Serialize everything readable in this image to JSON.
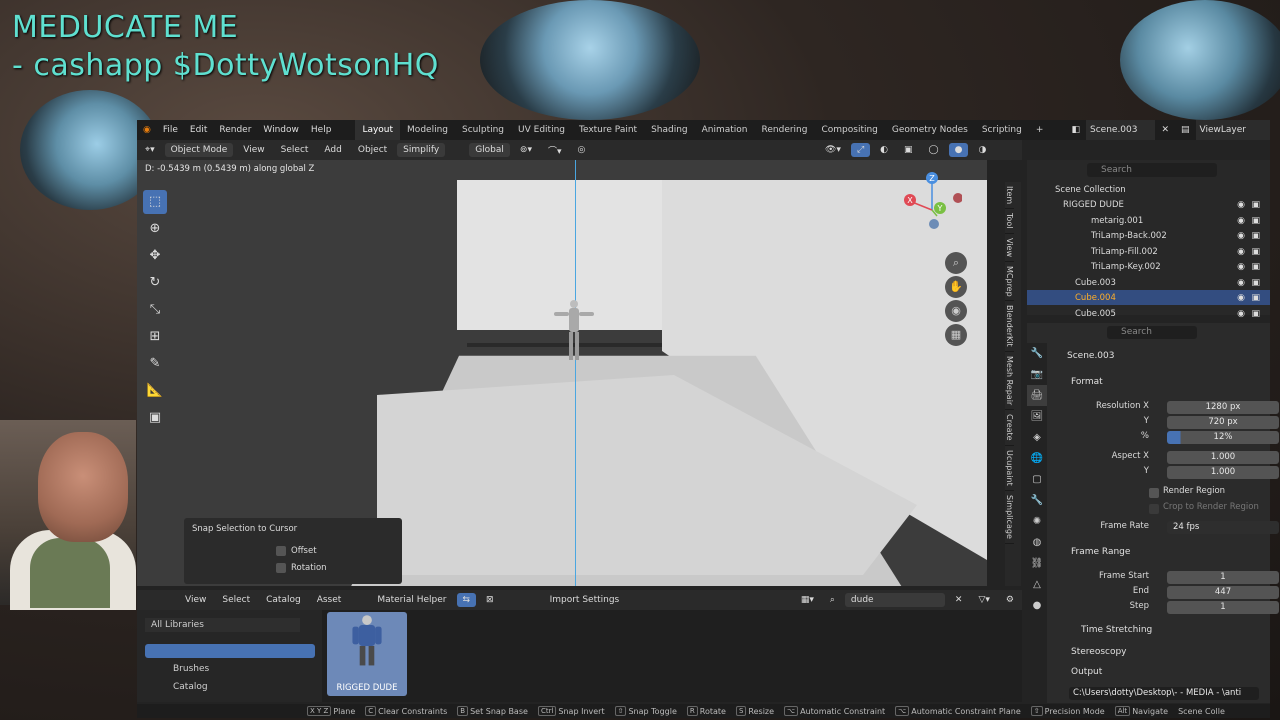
{
  "overlay": {
    "line1": "MEDUCATE ME",
    "line2": "- cashapp $DottyWotsonHQ"
  },
  "topbar": {
    "menus": [
      "File",
      "Edit",
      "Render",
      "Window",
      "Help"
    ],
    "workspaces": [
      "Layout",
      "Modeling",
      "Sculpting",
      "UV Editing",
      "Texture Paint",
      "Shading",
      "Animation",
      "Rendering",
      "Compositing",
      "Geometry Nodes",
      "Scripting"
    ],
    "active_workspace": "Layout",
    "scene": "Scene.003",
    "viewlayer": "ViewLayer"
  },
  "viewport_header": {
    "mode": "Object Mode",
    "menus": [
      "View",
      "Select",
      "Add",
      "Object"
    ],
    "simplify": "Simplify",
    "orientation": "Global"
  },
  "viewport": {
    "operator_status": "D: -0.5439 m (0.5439 m) along global Z",
    "gizmo": {
      "x": "X",
      "y": "Y",
      "z": "Z"
    },
    "side_tabs": [
      "Item",
      "Tool",
      "View",
      "MCprep",
      "BlenderKit",
      "Mesh Repair",
      "Create",
      "Ucupaint",
      "Simplicage"
    ]
  },
  "snap_panel": {
    "title": "Snap Selection to Cursor",
    "offset": "Offset",
    "rotation": "Rotation"
  },
  "asset_browser": {
    "menus": [
      "View",
      "Select",
      "Catalog",
      "Asset"
    ],
    "material_helper": "Material Helper",
    "import_settings": "Import Settings",
    "library": "All Libraries",
    "search": "dude",
    "side_items": [
      "Brushes",
      "Catalog"
    ],
    "asset_name": "RIGGED DUDE"
  },
  "outliner": {
    "search_placeholder": "Search",
    "rows": [
      {
        "label": "Scene Collection",
        "level": 0
      },
      {
        "label": "RIGGED DUDE",
        "level": 1
      },
      {
        "label": "metarig.001",
        "level": 2
      },
      {
        "label": "TriLamp-Back.002",
        "level": 2
      },
      {
        "label": "TriLamp-Fill.002",
        "level": 2
      },
      {
        "label": "TriLamp-Key.002",
        "level": 2
      },
      {
        "label": "Cube.003",
        "level": 1
      },
      {
        "label": "Cube.004",
        "level": 1
      },
      {
        "label": "Cube.005",
        "level": 1
      }
    ],
    "selected": "Cube.004"
  },
  "properties": {
    "search_placeholder": "Search",
    "scene_name": "Scene.003",
    "format_label": "Format",
    "resolution_x_label": "Resolution X",
    "resolution_x": "1280 px",
    "y_label": "Y",
    "resolution_y": "720 px",
    "pct_label": "%",
    "resolution_pct": "12%",
    "aspect_x_label": "Aspect X",
    "aspect_x": "1.000",
    "aspect_y_label": "Y",
    "aspect_y": "1.000",
    "render_region": "Render Region",
    "crop_region": "Crop to Render Region",
    "frame_rate_label": "Frame Rate",
    "frame_rate": "24 fps",
    "frame_range_label": "Frame Range",
    "frame_start_label": "Frame Start",
    "frame_start": "1",
    "end_label": "End",
    "frame_end": "447",
    "step_label": "Step",
    "frame_step": "1",
    "time_stretching": "Time Stretching",
    "stereoscopy": "Stereoscopy",
    "output": "Output",
    "output_path": "C:\\Users\\dotty\\Desktop\\- - MEDIA - \\anti"
  },
  "status_bar": [
    {
      "key": "X Y Z",
      "label": "Plane"
    },
    {
      "key": "C",
      "label": "Clear Constraints"
    },
    {
      "key": "B",
      "label": "Set Snap Base"
    },
    {
      "key": "Ctrl",
      "label": "Snap Invert"
    },
    {
      "key": "⇧",
      "label": "Snap Toggle"
    },
    {
      "key": "R",
      "label": "Rotate"
    },
    {
      "key": "S",
      "label": "Resize"
    },
    {
      "key": "⌥",
      "label": "Automatic Constraint"
    },
    {
      "key": "⌥",
      "label": "Automatic Constraint Plane"
    },
    {
      "key": "⇧",
      "label": "Precision Mode"
    },
    {
      "key": "Alt",
      "label": "Navigate"
    },
    {
      "key": "",
      "label": "Scene Colle"
    }
  ]
}
